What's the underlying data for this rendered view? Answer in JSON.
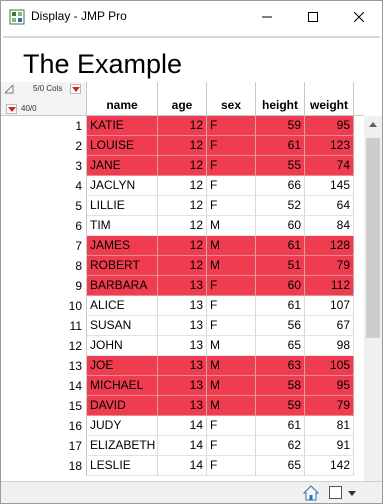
{
  "window": {
    "title": "Display - JMP Pro"
  },
  "report": {
    "heading": "The Example"
  },
  "table": {
    "cols_info": "5/0 Cols",
    "rows_info": "40/0",
    "columns": [
      "name",
      "age",
      "sex",
      "height",
      "weight"
    ],
    "rows": [
      {
        "n": "1",
        "name": "KATIE",
        "age": "12",
        "sex": "F",
        "height": "59",
        "weight": "95",
        "selected": true
      },
      {
        "n": "2",
        "name": "LOUISE",
        "age": "12",
        "sex": "F",
        "height": "61",
        "weight": "123",
        "selected": true
      },
      {
        "n": "3",
        "name": "JANE",
        "age": "12",
        "sex": "F",
        "height": "55",
        "weight": "74",
        "selected": true
      },
      {
        "n": "4",
        "name": "JACLYN",
        "age": "12",
        "sex": "F",
        "height": "66",
        "weight": "145",
        "selected": false
      },
      {
        "n": "5",
        "name": "LILLIE",
        "age": "12",
        "sex": "F",
        "height": "52",
        "weight": "64",
        "selected": false
      },
      {
        "n": "6",
        "name": "TIM",
        "age": "12",
        "sex": "M",
        "height": "60",
        "weight": "84",
        "selected": false
      },
      {
        "n": "7",
        "name": "JAMES",
        "age": "12",
        "sex": "M",
        "height": "61",
        "weight": "128",
        "selected": true
      },
      {
        "n": "8",
        "name": "ROBERT",
        "age": "12",
        "sex": "M",
        "height": "51",
        "weight": "79",
        "selected": true
      },
      {
        "n": "9",
        "name": "BARBARA",
        "age": "13",
        "sex": "F",
        "height": "60",
        "weight": "112",
        "selected": true
      },
      {
        "n": "10",
        "name": "ALICE",
        "age": "13",
        "sex": "F",
        "height": "61",
        "weight": "107",
        "selected": false
      },
      {
        "n": "11",
        "name": "SUSAN",
        "age": "13",
        "sex": "F",
        "height": "56",
        "weight": "67",
        "selected": false
      },
      {
        "n": "12",
        "name": "JOHN",
        "age": "13",
        "sex": "M",
        "height": "65",
        "weight": "98",
        "selected": false
      },
      {
        "n": "13",
        "name": "JOE",
        "age": "13",
        "sex": "M",
        "height": "63",
        "weight": "105",
        "selected": true
      },
      {
        "n": "14",
        "name": "MICHAEL",
        "age": "13",
        "sex": "M",
        "height": "58",
        "weight": "95",
        "selected": true
      },
      {
        "n": "15",
        "name": "DAVID",
        "age": "13",
        "sex": "M",
        "height": "59",
        "weight": "79",
        "selected": true
      },
      {
        "n": "16",
        "name": "JUDY",
        "age": "14",
        "sex": "F",
        "height": "61",
        "weight": "81",
        "selected": false
      },
      {
        "n": "17",
        "name": "ELIZABETH",
        "age": "14",
        "sex": "F",
        "height": "62",
        "weight": "91",
        "selected": false
      },
      {
        "n": "18",
        "name": "LESLIE",
        "age": "14",
        "sex": "F",
        "height": "65",
        "weight": "142",
        "selected": false
      }
    ]
  },
  "colors": {
    "selected_row": "#ef3c4f",
    "title_rule": "#cfd9e6"
  },
  "icons": [
    "jmp-app-icon",
    "minimize-icon",
    "maximize-icon",
    "close-icon",
    "home-icon",
    "square-icon",
    "dropdown-icon"
  ]
}
